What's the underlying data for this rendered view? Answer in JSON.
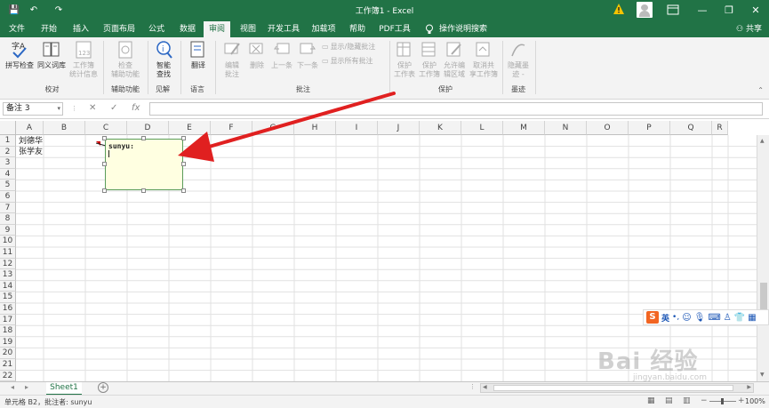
{
  "titlebar": {
    "title": "工作簿1 - Excel",
    "qa_save": "💾",
    "qa_undo": "↶",
    "qa_redo": "↷",
    "minimize": "—",
    "restore": "❐",
    "close": "✕"
  },
  "tabs": [
    {
      "label": "文件",
      "active": false
    },
    {
      "label": "开始",
      "active": false
    },
    {
      "label": "插入",
      "active": false
    },
    {
      "label": "页面布局",
      "active": false
    },
    {
      "label": "公式",
      "active": false
    },
    {
      "label": "数据",
      "active": false
    },
    {
      "label": "审阅",
      "active": true
    },
    {
      "label": "视图",
      "active": false
    },
    {
      "label": "开发工具",
      "active": false
    },
    {
      "label": "加载项",
      "active": false
    },
    {
      "label": "帮助",
      "active": false
    },
    {
      "label": "PDF工具",
      "active": false
    },
    {
      "label": "操作说明搜索",
      "active": false
    }
  ],
  "share": "共享",
  "ribbon": {
    "spell": "拼写检查",
    "thesaurus": "同义词库",
    "stats_line1": "工作簿",
    "stats_line2": "统计信息",
    "group_proofing": "校对",
    "check_line1": "检查",
    "check_line2": "辅助功能",
    "group_access": "辅助功能",
    "smart_line1": "智能",
    "smart_line2": "查找",
    "group_insights": "见解",
    "translate": "翻译",
    "group_language": "语言",
    "edit_comment_line1": "编辑",
    "edit_comment_line2": "批注",
    "delete": "删除",
    "prev": "上一条",
    "next": "下一条",
    "show_hide": "显示/隐藏批注",
    "show_all": "显示所有批注",
    "group_comments": "批注",
    "protect_sheet_line1": "保护",
    "protect_sheet_line2": "工作表",
    "protect_book_line1": "保护",
    "protect_book_line2": "工作簿",
    "allow_edit_line1": "允许编",
    "allow_edit_line2": "辑区域",
    "unshare_line1": "取消共",
    "unshare_line2": "享工作簿",
    "group_protect": "保护",
    "hide_ink_line1": "隐藏墨",
    "hide_ink_line2": "迹 -",
    "group_ink": "墨迹"
  },
  "formula": {
    "namebox": "备注 3",
    "cancel": "✕",
    "enter": "✓",
    "fx": "fx"
  },
  "columns": [
    "A",
    "B",
    "C",
    "D",
    "E",
    "F",
    "G",
    "H",
    "I",
    "J",
    "K",
    "L",
    "M",
    "N",
    "O",
    "P",
    "Q",
    "R"
  ],
  "rows": [
    "1",
    "2",
    "3",
    "4",
    "5",
    "6",
    "7",
    "8",
    "9",
    "10",
    "11",
    "12",
    "13",
    "14",
    "15",
    "16",
    "17",
    "18",
    "19",
    "20",
    "21",
    "22"
  ],
  "cells": {
    "A1": "刘德华",
    "A2": "张学友"
  },
  "comment": {
    "author": "sunyu:"
  },
  "sheet_tab": "Sheet1",
  "add_sheet": "+",
  "status": {
    "left": "单元格 B2，批注者: sunyu",
    "zoom": "100%"
  },
  "ime": {
    "logo": "S",
    "mode": "英"
  },
  "watermark": {
    "main": "Bai 经验",
    "sub": "jingyan.baidu.com"
  },
  "colors": {
    "excel_green": "#217346",
    "arrow_red": "#e02020",
    "comment_bg": "#ffffe1"
  }
}
